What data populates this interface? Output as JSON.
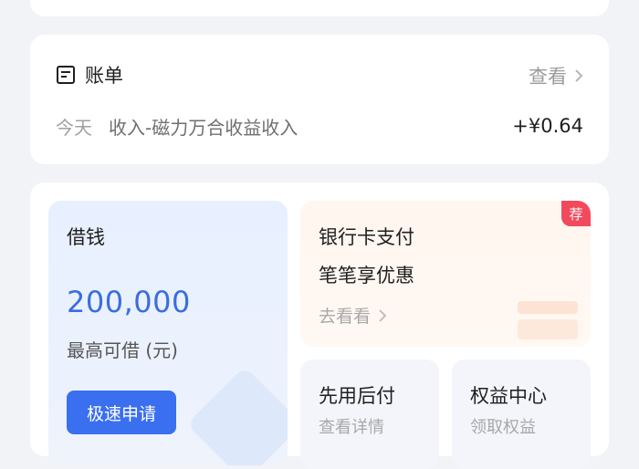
{
  "bill": {
    "title": "账单",
    "view_label": "查看",
    "date": "今天",
    "description": "收入-磁力万合收益收入",
    "amount": "+¥0.64"
  },
  "loan": {
    "title": "借钱",
    "amount": "200,000",
    "subtitle": "最高可借 (元)",
    "button_label": "极速申请"
  },
  "bank_pay": {
    "badge": "荐",
    "title": "银行卡支付",
    "subtitle": "笔笔享优惠",
    "link": "去看看"
  },
  "pay_later": {
    "title": "先用后付",
    "subtitle": "查看详情"
  },
  "benefits": {
    "title": "权益中心",
    "subtitle": "领取权益"
  },
  "colors": {
    "accent_blue": "#3a6ff0",
    "amount_blue": "#3a6ddf",
    "badge_red": "#f24a5c"
  }
}
